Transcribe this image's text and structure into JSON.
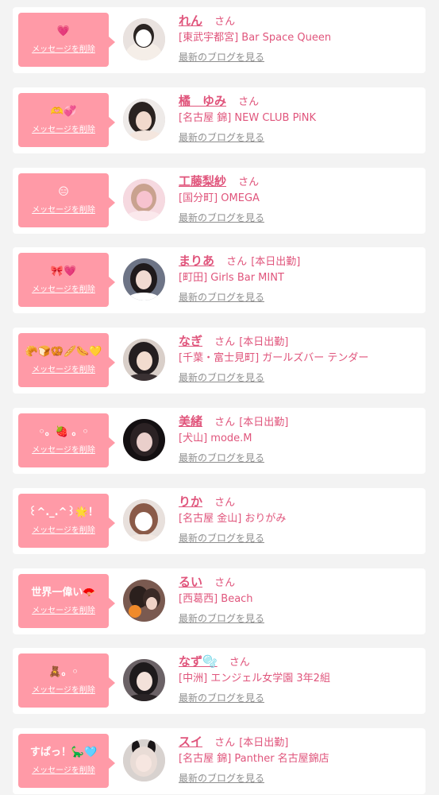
{
  "entries": [
    {
      "message": "💗",
      "delete_label": "メッセージを削除",
      "name": "れん",
      "honorific": "さん",
      "working": "",
      "shop": "[東武宇都宮] Bar Space Queen",
      "blog_link": "最新のブログを見る",
      "avatar_color": "#e9e2df"
    },
    {
      "message": "🫶💞",
      "delete_label": "メッセージを削除",
      "name": "橘　ゆみ",
      "honorific": "さん",
      "working": "",
      "shop": "[名古屋 錦] NEW CLUB PiNK",
      "blog_link": "最新のブログを見る",
      "avatar_color": "#3a302e"
    },
    {
      "message": "😑",
      "delete_label": "メッセージを削除",
      "name": "工藤梨紗",
      "honorific": "さん",
      "working": "",
      "shop": "[国分町] OMEGA",
      "blog_link": "最新のブログを見る",
      "avatar_color": "#f2b8c6"
    },
    {
      "message": "🎀💗",
      "delete_label": "メッセージを削除",
      "name": "まりあ",
      "honorific": "さん",
      "working": "[本日出勤]",
      "shop": "[町田] Girls Bar MINT",
      "blog_link": "最新のブログを見る",
      "avatar_color": "#4a5060"
    },
    {
      "message": "🥐🍞🥨🥖🌭💛",
      "delete_label": "メッセージを削除",
      "name": "なぎ",
      "honorific": "さん",
      "working": "[本日出勤]",
      "shop": "[千葉・富士見町] ガールズバー テンダー",
      "blog_link": "最新のブログを見る",
      "avatar_color": "#2e2a2c"
    },
    {
      "message": "◦。🍓 。◦",
      "delete_label": "メッセージを削除",
      "name": "美緒",
      "honorific": "さん",
      "working": "[本日出勤]",
      "shop": "[犬山] mode.M",
      "blog_link": "最新のブログを見る",
      "avatar_color": "#1e1a1c"
    },
    {
      "message": "꒰^._.^꒱🌟！",
      "delete_label": "メッセージを削除",
      "name": "りか",
      "honorific": "さん",
      "working": "",
      "shop": "[名古屋 金山] おりがみ",
      "blog_link": "最新のブログを見る",
      "avatar_color": "#c79a86"
    },
    {
      "message": "世界一偉い🪭",
      "delete_label": "メッセージを削除",
      "name": "るい",
      "honorific": "さん",
      "working": "",
      "shop": "[西葛西] Beach",
      "blog_link": "最新のブログを見る",
      "avatar_color": "#5a3f38"
    },
    {
      "message": "🧸。◦",
      "delete_label": "メッセージを削除",
      "name": "なず🫧",
      "honorific": "さん",
      "working": "",
      "shop": "[中洲] エンジェル女学園 3年2組",
      "blog_link": "最新のブログを見る",
      "avatar_color": "#4b4347"
    },
    {
      "message": "すぱっ！🦕🩵",
      "delete_label": "メッセージを削除",
      "name": "スイ",
      "honorific": "さん",
      "working": "[本日出勤]",
      "shop": "[名古屋 錦] Panther 名古屋錦店",
      "blog_link": "最新のブログを見る",
      "avatar_color": "#d8d2cf"
    }
  ]
}
